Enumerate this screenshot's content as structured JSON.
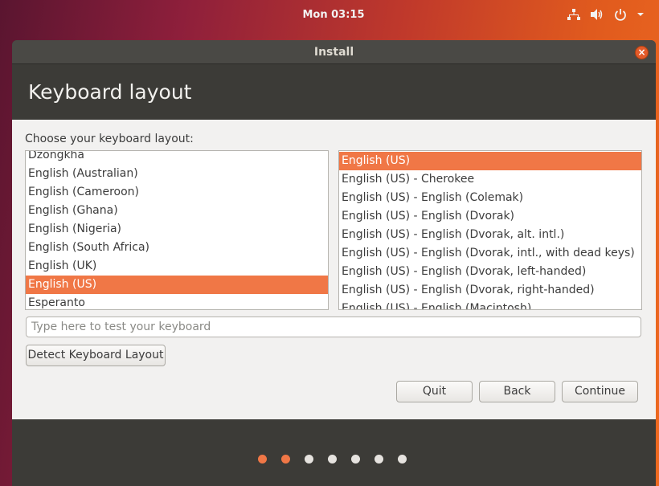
{
  "topbar": {
    "clock": "Mon 03:15",
    "icons": [
      "network-icon",
      "volume-icon",
      "power-icon",
      "dropdown-arrow-icon"
    ]
  },
  "window": {
    "title": "Install",
    "page_title": "Keyboard layout",
    "choose_label": "Choose your keyboard layout:"
  },
  "left_list": {
    "items": [
      {
        "label": "Dzongkha",
        "selected": false
      },
      {
        "label": "English (Australian)",
        "selected": false
      },
      {
        "label": "English (Cameroon)",
        "selected": false
      },
      {
        "label": "English (Ghana)",
        "selected": false
      },
      {
        "label": "English (Nigeria)",
        "selected": false
      },
      {
        "label": "English (South Africa)",
        "selected": false
      },
      {
        "label": "English (UK)",
        "selected": false
      },
      {
        "label": "English (US)",
        "selected": true
      },
      {
        "label": "Esperanto",
        "selected": false
      }
    ]
  },
  "right_list": {
    "items": [
      {
        "label": "English (US)",
        "selected": true
      },
      {
        "label": "English (US) - Cherokee",
        "selected": false
      },
      {
        "label": "English (US) - English (Colemak)",
        "selected": false
      },
      {
        "label": "English (US) - English (Dvorak)",
        "selected": false
      },
      {
        "label": "English (US) - English (Dvorak, alt. intl.)",
        "selected": false
      },
      {
        "label": "English (US) - English (Dvorak, intl., with dead keys)",
        "selected": false
      },
      {
        "label": "English (US) - English (Dvorak, left-handed)",
        "selected": false
      },
      {
        "label": "English (US) - English (Dvorak, right-handed)",
        "selected": false
      },
      {
        "label": "English (US) - English (Macintosh)",
        "selected": false
      }
    ]
  },
  "test_input": {
    "placeholder": "Type here to test your keyboard",
    "value": ""
  },
  "buttons": {
    "detect": "Detect Keyboard Layout",
    "quit": "Quit",
    "back": "Back",
    "continue": "Continue"
  },
  "progress": {
    "steps": [
      true,
      true,
      false,
      false,
      false,
      false,
      false
    ]
  },
  "colors": {
    "accent": "#f07746",
    "window_dark": "#3c3b37",
    "content_bg": "#f2f1f0"
  }
}
